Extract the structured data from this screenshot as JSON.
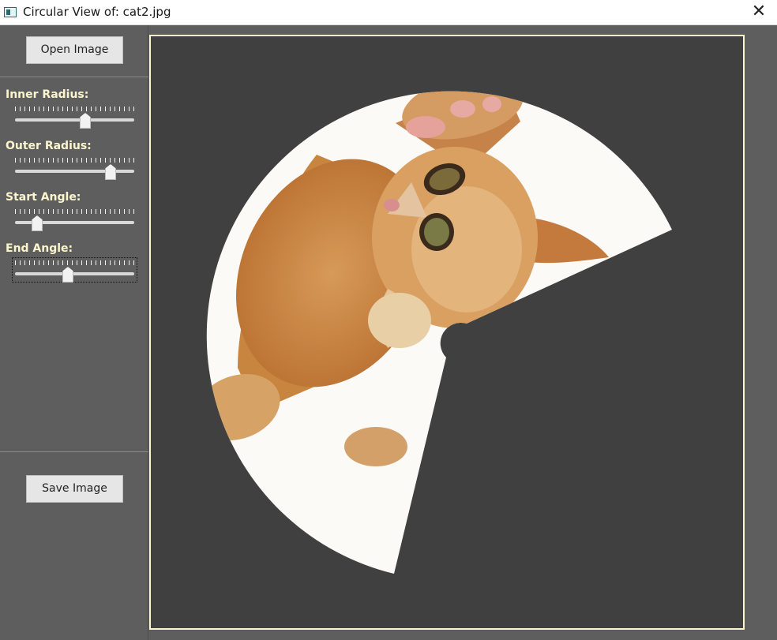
{
  "window": {
    "title": "Circular View of: cat2.jpg",
    "close_glyph": "✕",
    "icon": "app-window-icon"
  },
  "sidebar": {
    "open_label": "Open Image",
    "save_label": "Save Image",
    "sliders": [
      {
        "label": "Inner Radius:",
        "value_fraction": 0.6
      },
      {
        "label": "Outer Radius:",
        "value_fraction": 0.83
      },
      {
        "label": "Start Angle:",
        "value_fraction": 0.15
      },
      {
        "label": "End Angle:",
        "value_fraction": 0.44
      }
    ]
  },
  "colors": {
    "label_color": "#fbf5cd",
    "canvas_border": "#fbf5cd",
    "canvas_bg": "#404040",
    "panel_bg": "#5e5e5e"
  }
}
